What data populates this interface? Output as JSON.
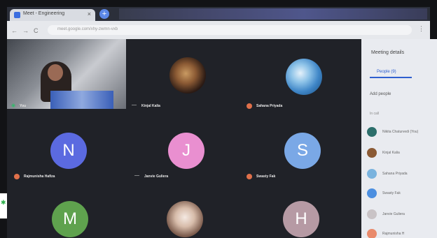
{
  "browser": {
    "tab_title": "Meet - Engineering",
    "tab_close": "×",
    "new_tab": "+",
    "nav_back": "←",
    "nav_forward": "→",
    "nav_reload": "C",
    "url": "meet.google.com/xhy-zwmn-vxb",
    "menu": "⋮"
  },
  "tiles": [
    {
      "name": "You",
      "type": "self"
    },
    {
      "name": "Kinjal Kalia",
      "type": "photo"
    },
    {
      "name": "Sahana Priyada",
      "type": "photo"
    },
    {
      "name": "Rajmunisha Hafiza",
      "type": "letter",
      "letter": "N"
    },
    {
      "name": "Janvie Guliera",
      "type": "letter",
      "letter": "J"
    },
    {
      "name": "Swasty Fak",
      "type": "letter",
      "letter": "S"
    },
    {
      "name": "",
      "type": "letter",
      "letter": "M"
    },
    {
      "name": "",
      "type": "photo"
    },
    {
      "name": "",
      "type": "letter",
      "letter": "H"
    }
  ],
  "colors": {
    "N": "#5b6ae0",
    "J": "#e98fd0",
    "S": "#7aa8e6",
    "M": "#5fa24e",
    "H": "#b69aa4"
  },
  "sidebar": {
    "title": "Meeting details",
    "people_tab": "People (9)",
    "add_people": "Add people",
    "section": "In call",
    "participants": [
      "Nikita Chaturvedi (You)",
      "Kinjal Kalia",
      "Sahana Priyada",
      "Swasty Fak",
      "Janvie Guliera",
      "Rajmunisha H"
    ]
  },
  "left_glyph": "✱"
}
